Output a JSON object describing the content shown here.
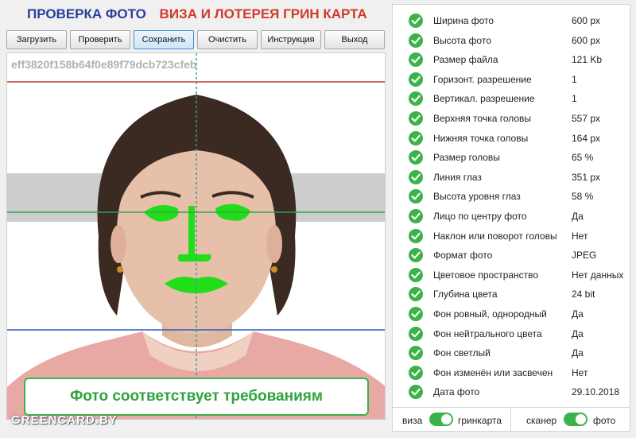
{
  "header": {
    "title_left": "ПРОВЕРКА ФОТО",
    "title_right": "ВИЗА И ЛОТЕРЕЯ ГРИН КАРТА"
  },
  "toolbar": {
    "buttons": [
      {
        "label": "Загрузить"
      },
      {
        "label": "Проверить"
      },
      {
        "label": "Сохранить",
        "active": true
      },
      {
        "label": "Очистить"
      },
      {
        "label": "Инструкция"
      },
      {
        "label": "Выход"
      }
    ]
  },
  "photo": {
    "filename": "eff3820f158b64f0e89f79dcb723cfeb",
    "verdict": "Фото соответствует требованиям"
  },
  "watermark": "GREENCARD.BY",
  "checks": [
    {
      "label": "Ширина фото",
      "value": "600 px"
    },
    {
      "label": "Высота фото",
      "value": "600 px"
    },
    {
      "label": "Размер файла",
      "value": "121 Kb"
    },
    {
      "label": "Горизонт. разрешение",
      "value": "1"
    },
    {
      "label": "Вертикал. разрешение",
      "value": "1"
    },
    {
      "label": "Верхняя точка головы",
      "value": "557 px"
    },
    {
      "label": "Нижняя точка головы",
      "value": "164 px"
    },
    {
      "label": "Размер головы",
      "value": "65 %"
    },
    {
      "label": "Линия глаз",
      "value": "351 px"
    },
    {
      "label": "Высота уровня глаз",
      "value": "58 %"
    },
    {
      "label": "Лицо по центру фото",
      "value": "Да"
    },
    {
      "label": "Наклон или поворот головы",
      "value": "Нет"
    },
    {
      "label": "Формат фото",
      "value": "JPEG"
    },
    {
      "label": "Цветовое пространство",
      "value": "Нет данных"
    },
    {
      "label": "Глубина цвета",
      "value": "24 bit"
    },
    {
      "label": "Фон ровный, однородный",
      "value": "Да"
    },
    {
      "label": "Фон нейтрального цвета",
      "value": "Да"
    },
    {
      "label": "Фон светлый",
      "value": "Да"
    },
    {
      "label": "Фон изменён или засвечен",
      "value": "Нет"
    },
    {
      "label": "Дата фото",
      "value": "29.10.2018"
    }
  ],
  "toggles": {
    "left_off": "виза",
    "left_on": "гринкарта",
    "left_state": "on",
    "right_off": "сканер",
    "right_on": "фото",
    "right_state": "on"
  },
  "colors": {
    "title_blue": "#2a3f9a",
    "title_red": "#d03a2a",
    "check_green": "#3cb34a",
    "verdict_green": "#2fa43c",
    "guide_red": "#c0392b",
    "guide_green": "#2fa44f",
    "guide_blue": "#2e5ec9",
    "center_dashed": "#3a9aa6",
    "overlay_green": "#22dd1a"
  }
}
